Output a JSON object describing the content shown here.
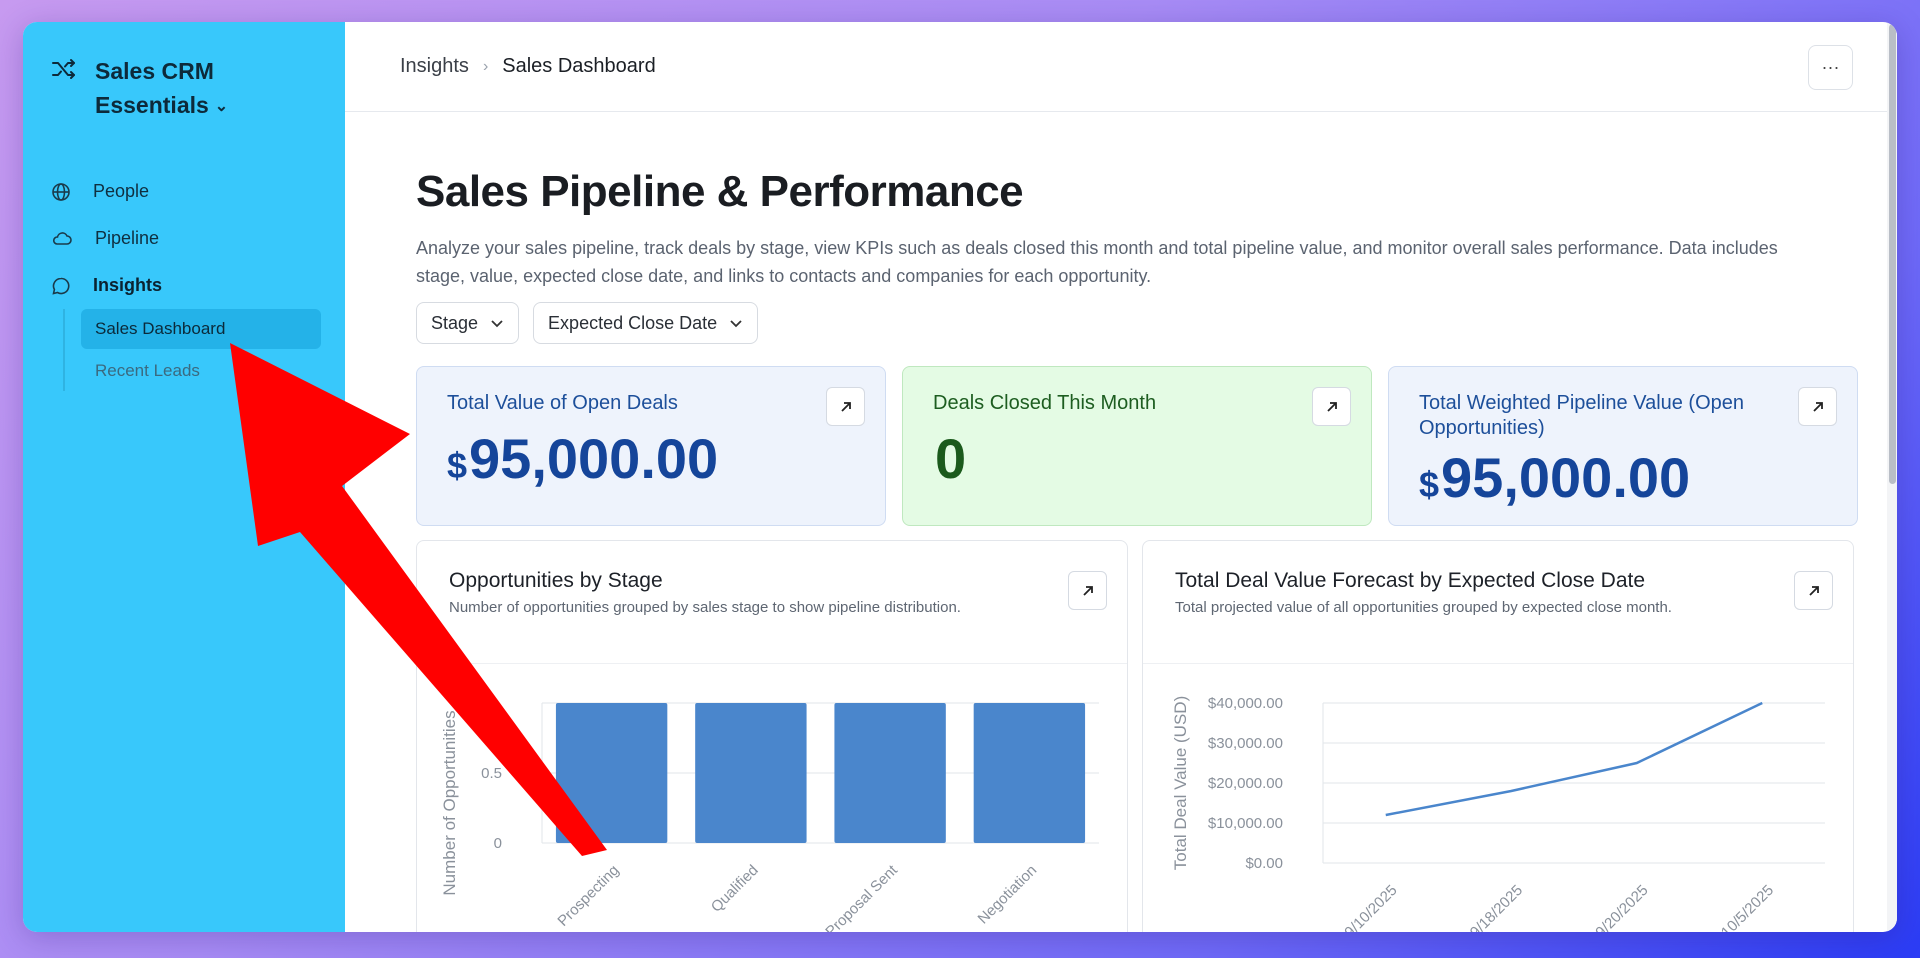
{
  "app": {
    "title": "Sales CRM Essentials"
  },
  "nav": {
    "items": [
      {
        "label": "People",
        "icon": "globe-icon"
      },
      {
        "label": "Pipeline",
        "icon": "cloud-icon"
      },
      {
        "label": "Insights",
        "icon": "chat-bubble-icon"
      }
    ],
    "sub_items": [
      {
        "label": "Sales Dashboard",
        "active": true
      },
      {
        "label": "Recent Leads",
        "active": false
      }
    ]
  },
  "breadcrumb": {
    "parent": "Insights",
    "current": "Sales Dashboard"
  },
  "more_button": "···",
  "page": {
    "title": "Sales Pipeline & Performance",
    "description": "Analyze your sales pipeline, track deals by stage, view KPIs such as deals closed this month and total pipeline value, and monitor overall sales performance. Data includes stage, value, expected close date, and links to contacts and companies for each opportunity."
  },
  "filters": [
    {
      "label": "Stage"
    },
    {
      "label": "Expected Close Date"
    }
  ],
  "kpis": [
    {
      "title": "Total Value of Open Deals",
      "currency": "$",
      "value": "95,000.00"
    },
    {
      "title": "Deals Closed This Month",
      "currency": "",
      "value": "0"
    },
    {
      "title": "Total Weighted Pipeline Value (Open Opportunities)",
      "currency": "$",
      "value": "95,000.00"
    }
  ],
  "cards": [
    {
      "title": "Opportunities by Stage",
      "subtitle": "Number of opportunities grouped by sales stage to show pipeline distribution."
    },
    {
      "title": "Total Deal Value Forecast by Expected Close Date",
      "subtitle": "Total projected value of all opportunities grouped by expected close month."
    }
  ],
  "chart_data": [
    {
      "type": "bar",
      "title": "Opportunities by Stage",
      "categories": [
        "Prospecting",
        "Qualified",
        "Proposal Sent",
        "Negotiation"
      ],
      "values": [
        1,
        1,
        1,
        1
      ],
      "ylabel": "Number of Opportunities",
      "yticks": [
        "0",
        "0.5"
      ],
      "ylim": [
        0,
        1
      ],
      "color": "#4a86cc",
      "grid": true
    },
    {
      "type": "line",
      "title": "Total Deal Value Forecast by Expected Close Date",
      "x": [
        "9/10/2025",
        "9/18/2025",
        "9/20/2025",
        "10/5/2025"
      ],
      "values": [
        12000,
        18000,
        25000,
        40000
      ],
      "ylabel": "Total Deal Value (USD)",
      "yticks": [
        "$0.00",
        "$10,000.00",
        "$20,000.00",
        "$30,000.00",
        "$40,000.00"
      ],
      "ylim": [
        0,
        40000
      ],
      "color": "#4a86cc",
      "grid": true
    }
  ],
  "colors": {
    "sidebar": "#38c8fb",
    "accent": "#15459a",
    "annotation_arrow": "#ff0000"
  }
}
